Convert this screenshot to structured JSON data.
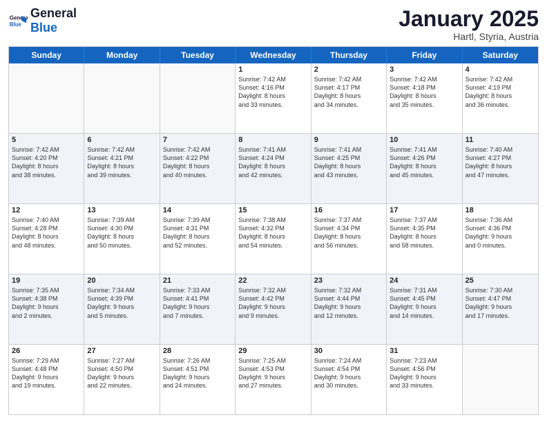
{
  "header": {
    "logo_general": "General",
    "logo_blue": "Blue",
    "month_title": "January 2025",
    "location": "Hartl, Styria, Austria"
  },
  "days_of_week": [
    "Sunday",
    "Monday",
    "Tuesday",
    "Wednesday",
    "Thursday",
    "Friday",
    "Saturday"
  ],
  "rows": [
    [
      {
        "day": "",
        "text": ""
      },
      {
        "day": "",
        "text": ""
      },
      {
        "day": "",
        "text": ""
      },
      {
        "day": "1",
        "text": "Sunrise: 7:42 AM\nSunset: 4:16 PM\nDaylight: 8 hours\nand 33 minutes."
      },
      {
        "day": "2",
        "text": "Sunrise: 7:42 AM\nSunset: 4:17 PM\nDaylight: 8 hours\nand 34 minutes."
      },
      {
        "day": "3",
        "text": "Sunrise: 7:42 AM\nSunset: 4:18 PM\nDaylight: 8 hours\nand 35 minutes."
      },
      {
        "day": "4",
        "text": "Sunrise: 7:42 AM\nSunset: 4:19 PM\nDaylight: 8 hours\nand 36 minutes."
      }
    ],
    [
      {
        "day": "5",
        "text": "Sunrise: 7:42 AM\nSunset: 4:20 PM\nDaylight: 8 hours\nand 38 minutes."
      },
      {
        "day": "6",
        "text": "Sunrise: 7:42 AM\nSunset: 4:21 PM\nDaylight: 8 hours\nand 39 minutes."
      },
      {
        "day": "7",
        "text": "Sunrise: 7:42 AM\nSunset: 4:22 PM\nDaylight: 8 hours\nand 40 minutes."
      },
      {
        "day": "8",
        "text": "Sunrise: 7:41 AM\nSunset: 4:24 PM\nDaylight: 8 hours\nand 42 minutes."
      },
      {
        "day": "9",
        "text": "Sunrise: 7:41 AM\nSunset: 4:25 PM\nDaylight: 8 hours\nand 43 minutes."
      },
      {
        "day": "10",
        "text": "Sunrise: 7:41 AM\nSunset: 4:26 PM\nDaylight: 8 hours\nand 45 minutes."
      },
      {
        "day": "11",
        "text": "Sunrise: 7:40 AM\nSunset: 4:27 PM\nDaylight: 8 hours\nand 47 minutes."
      }
    ],
    [
      {
        "day": "12",
        "text": "Sunrise: 7:40 AM\nSunset: 4:28 PM\nDaylight: 8 hours\nand 48 minutes."
      },
      {
        "day": "13",
        "text": "Sunrise: 7:39 AM\nSunset: 4:30 PM\nDaylight: 8 hours\nand 50 minutes."
      },
      {
        "day": "14",
        "text": "Sunrise: 7:39 AM\nSunset: 4:31 PM\nDaylight: 8 hours\nand 52 minutes."
      },
      {
        "day": "15",
        "text": "Sunrise: 7:38 AM\nSunset: 4:32 PM\nDaylight: 8 hours\nand 54 minutes."
      },
      {
        "day": "16",
        "text": "Sunrise: 7:37 AM\nSunset: 4:34 PM\nDaylight: 8 hours\nand 56 minutes."
      },
      {
        "day": "17",
        "text": "Sunrise: 7:37 AM\nSunset: 4:35 PM\nDaylight: 8 hours\nand 58 minutes."
      },
      {
        "day": "18",
        "text": "Sunrise: 7:36 AM\nSunset: 4:36 PM\nDaylight: 9 hours\nand 0 minutes."
      }
    ],
    [
      {
        "day": "19",
        "text": "Sunrise: 7:35 AM\nSunset: 4:38 PM\nDaylight: 9 hours\nand 2 minutes."
      },
      {
        "day": "20",
        "text": "Sunrise: 7:34 AM\nSunset: 4:39 PM\nDaylight: 9 hours\nand 5 minutes."
      },
      {
        "day": "21",
        "text": "Sunrise: 7:33 AM\nSunset: 4:41 PM\nDaylight: 9 hours\nand 7 minutes."
      },
      {
        "day": "22",
        "text": "Sunrise: 7:32 AM\nSunset: 4:42 PM\nDaylight: 9 hours\nand 9 minutes."
      },
      {
        "day": "23",
        "text": "Sunrise: 7:32 AM\nSunset: 4:44 PM\nDaylight: 9 hours\nand 12 minutes."
      },
      {
        "day": "24",
        "text": "Sunrise: 7:31 AM\nSunset: 4:45 PM\nDaylight: 9 hours\nand 14 minutes."
      },
      {
        "day": "25",
        "text": "Sunrise: 7:30 AM\nSunset: 4:47 PM\nDaylight: 9 hours\nand 17 minutes."
      }
    ],
    [
      {
        "day": "26",
        "text": "Sunrise: 7:29 AM\nSunset: 4:48 PM\nDaylight: 9 hours\nand 19 minutes."
      },
      {
        "day": "27",
        "text": "Sunrise: 7:27 AM\nSunset: 4:50 PM\nDaylight: 9 hours\nand 22 minutes."
      },
      {
        "day": "28",
        "text": "Sunrise: 7:26 AM\nSunset: 4:51 PM\nDaylight: 9 hours\nand 24 minutes."
      },
      {
        "day": "29",
        "text": "Sunrise: 7:25 AM\nSunset: 4:53 PM\nDaylight: 9 hours\nand 27 minutes."
      },
      {
        "day": "30",
        "text": "Sunrise: 7:24 AM\nSunset: 4:54 PM\nDaylight: 9 hours\nand 30 minutes."
      },
      {
        "day": "31",
        "text": "Sunrise: 7:23 AM\nSunset: 4:56 PM\nDaylight: 9 hours\nand 33 minutes."
      },
      {
        "day": "",
        "text": ""
      }
    ]
  ]
}
